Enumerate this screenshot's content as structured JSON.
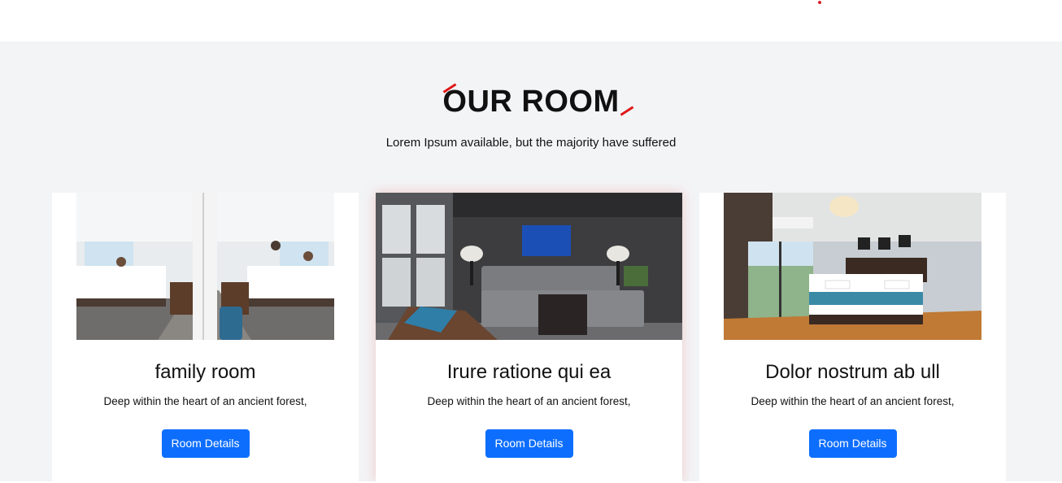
{
  "section": {
    "title": "OUR ROOM",
    "subtitle": "Lorem Ipsum available, but the majority have suffered"
  },
  "rooms": [
    {
      "title": "family room",
      "description": "Deep within the heart of an ancient forest,",
      "button_label": "Room Details"
    },
    {
      "title": "Irure ratione qui ea",
      "description": "Deep within the heart of an ancient forest,",
      "button_label": "Room Details"
    },
    {
      "title": "Dolor nostrum ab ull",
      "description": "Deep within the heart of an ancient forest,",
      "button_label": "Room Details"
    }
  ],
  "colors": {
    "accent": "#e01818",
    "button": "#0d6efd",
    "background": "#f3f4f6"
  }
}
